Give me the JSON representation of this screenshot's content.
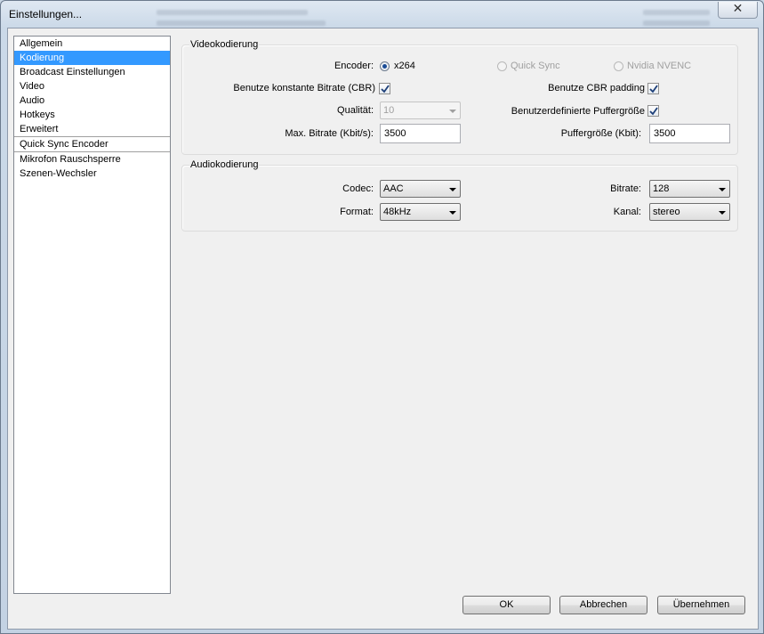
{
  "window": {
    "title": "Einstellungen...",
    "close_glyph": "✕"
  },
  "sidebar": {
    "items": [
      {
        "label": "Allgemein"
      },
      {
        "label": "Kodierung",
        "selected": true
      },
      {
        "label": "Broadcast Einstellungen"
      },
      {
        "label": "Video"
      },
      {
        "label": "Audio"
      },
      {
        "label": "Hotkeys"
      },
      {
        "label": "Erweitert"
      },
      {
        "label": "Quick Sync Encoder"
      },
      {
        "label": "Mikrofon Rauschsperre"
      },
      {
        "label": "Szenen-Wechsler"
      }
    ]
  },
  "video": {
    "group_label": "Videokodierung",
    "encoder_label": "Encoder:",
    "encoder_options": [
      {
        "label": "x264",
        "checked": true,
        "enabled": true
      },
      {
        "label": "Quick Sync",
        "checked": false,
        "enabled": false
      },
      {
        "label": "Nvidia NVENC",
        "checked": false,
        "enabled": false
      }
    ],
    "cbr_label": "Benutze konstante Bitrate (CBR)",
    "cbr_checked": true,
    "cbr_padding_label": "Benutze CBR padding",
    "cbr_padding_checked": true,
    "quality_label": "Qualität:",
    "quality_value": "10",
    "custom_buffer_label": "Benutzerdefinierte Puffergröße",
    "custom_buffer_checked": true,
    "max_bitrate_label": "Max. Bitrate (Kbit/s):",
    "max_bitrate_value": "3500",
    "buffer_size_label": "Puffergröße (Kbit):",
    "buffer_size_value": "3500"
  },
  "audio": {
    "group_label": "Audiokodierung",
    "codec_label": "Codec:",
    "codec_value": "AAC",
    "bitrate_label": "Bitrate:",
    "bitrate_value": "128",
    "format_label": "Format:",
    "format_value": "48kHz",
    "channel_label": "Kanal:",
    "channel_value": "stereo"
  },
  "buttons": {
    "ok": "OK",
    "cancel": "Abbrechen",
    "apply": "Übernehmen"
  },
  "colors": {
    "selection": "#3399ff",
    "check_mark": "#1c3e78"
  },
  "icons": {
    "close": "close-icon",
    "radio": "radio-icon",
    "check": "check-icon",
    "dropdown": "chevron-down-icon"
  }
}
